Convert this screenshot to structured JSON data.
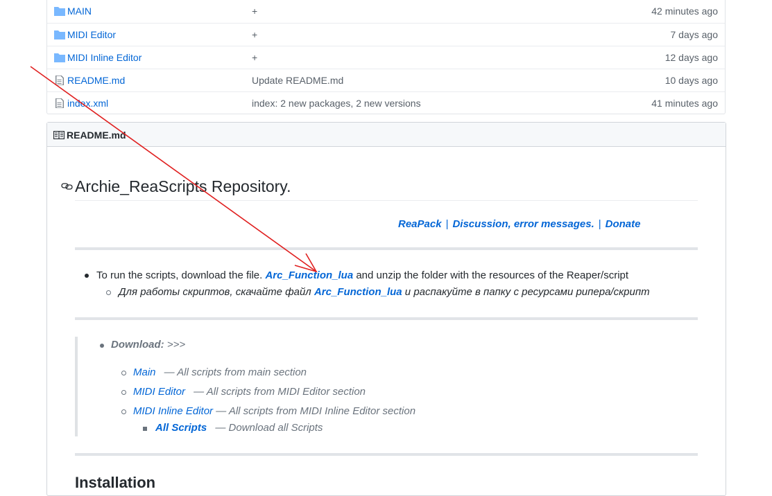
{
  "files": [
    {
      "name": "MAIN",
      "icon": "folder-icon",
      "message": "+",
      "age": "42 minutes ago"
    },
    {
      "name": "MIDI Editor",
      "icon": "folder-icon",
      "message": "+",
      "age": "7 days ago"
    },
    {
      "name": "MIDI Inline Editor",
      "icon": "folder-icon",
      "message": "+",
      "age": "12 days ago"
    },
    {
      "name": "README.md",
      "icon": "file-icon",
      "message": "Update README.md",
      "age": "10 days ago"
    },
    {
      "name": "index.xml",
      "icon": "file-icon",
      "message": "index: 2 new packages, 2 new versions",
      "age": "41 minutes ago"
    }
  ],
  "readme": {
    "header_title": "README.md",
    "heading": "Archie_ReaScripts Repository.",
    "top_links": {
      "reapack": "ReaPack",
      "discussion": "Discussion, error messages.",
      "donate": "Donate",
      "separator": "|"
    },
    "run_scripts": {
      "before": "To run the scripts, download the file. ",
      "link": "Arc_Function_lua",
      "after": " and unzip the folder with the resources of the Reaper/script"
    },
    "run_scripts_ru": {
      "before": "Для работы скриптов, скачайте файл ",
      "link": "Arc_Function_lua",
      "after": " и распакуйте в папку с ресурсами рипера/скрипт"
    },
    "download": {
      "label": "Download:",
      "arrows": " >>>",
      "items": [
        {
          "link": "Main",
          "sep": " — ",
          "desc": " All scripts from main section"
        },
        {
          "link": "MIDI Editor",
          "sep": " — ",
          "desc": " All scripts from MIDI Editor section"
        },
        {
          "link": "MIDI Inline Editor",
          "sep": " — ",
          "desc": "All scripts from MIDI Inline Editor section"
        }
      ],
      "all_scripts": {
        "link": "All Scripts",
        "sep": " — ",
        "desc": " Download all Scripts"
      }
    },
    "installation_heading": "Installation"
  },
  "colors": {
    "link": "#0366d6",
    "arrow": "#e02020",
    "folder": "#79b8ff"
  }
}
